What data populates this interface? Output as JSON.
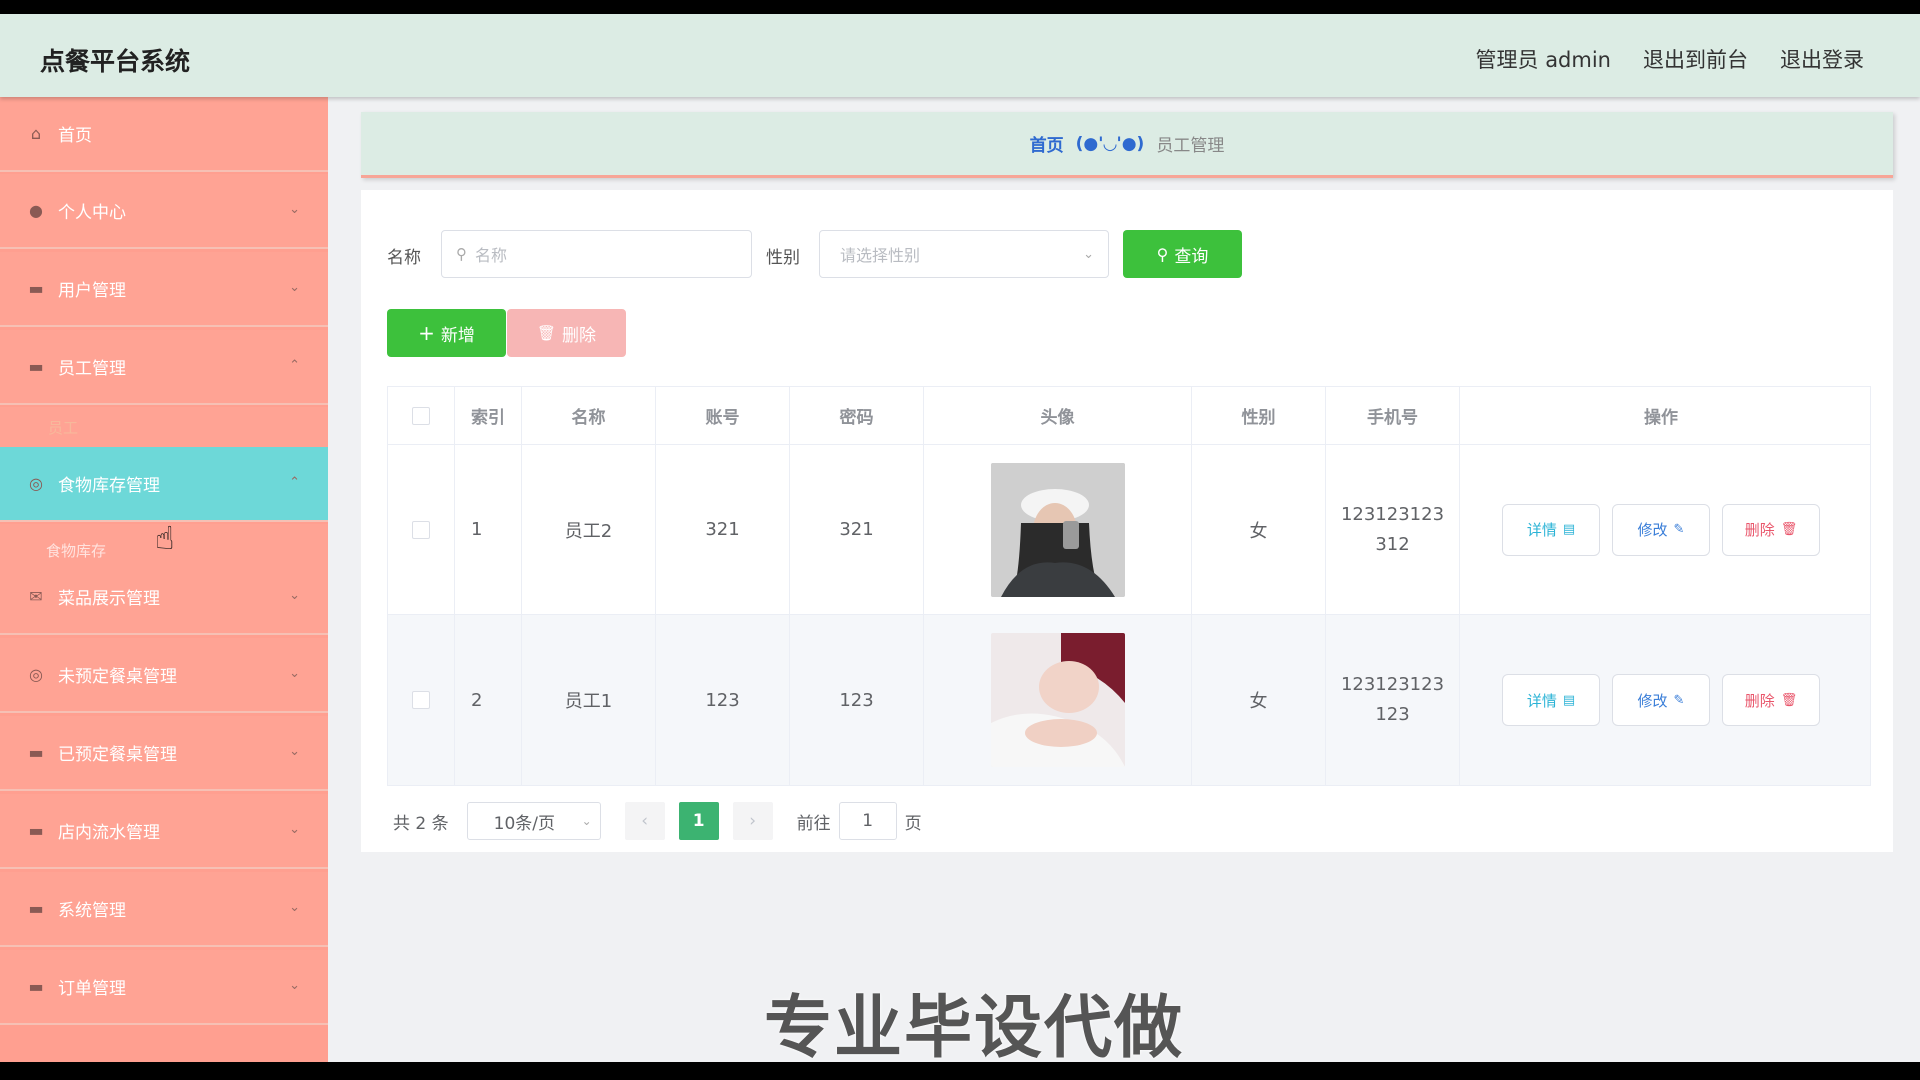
{
  "header": {
    "title": "点餐平台系统",
    "user": "管理员 admin",
    "to_front": "退出到前台",
    "logout": "退出登录"
  },
  "sidebar": {
    "items": [
      {
        "label": "首页",
        "icon": "home-icon",
        "glyph": "⌂",
        "has_chevron": false
      },
      {
        "label": "个人中心",
        "icon": "user-icon",
        "glyph": "👤",
        "has_chevron": true
      },
      {
        "label": "用户管理",
        "icon": "briefcase-icon",
        "glyph": "▬",
        "has_chevron": true
      },
      {
        "label": "员工管理",
        "icon": "monitor-icon",
        "glyph": "▬",
        "has_chevron": true
      },
      {
        "label": "食物库存管理",
        "icon": "compass-icon",
        "glyph": "◎",
        "has_chevron": true
      },
      {
        "label": "菜品展示管理",
        "icon": "mail-icon",
        "glyph": "✉",
        "has_chevron": true
      },
      {
        "label": "未预定餐桌管理",
        "icon": "lifebuoy-icon",
        "glyph": "◎",
        "has_chevron": true
      },
      {
        "label": "已预定餐桌管理",
        "icon": "message-icon",
        "glyph": "▬",
        "has_chevron": true
      },
      {
        "label": "店内流水管理",
        "icon": "ticket-icon",
        "glyph": "▬",
        "has_chevron": true
      },
      {
        "label": "系统管理",
        "icon": "system-icon",
        "glyph": "▬",
        "has_chevron": true
      },
      {
        "label": "订单管理",
        "icon": "order-icon",
        "glyph": "▬",
        "has_chevron": true
      }
    ],
    "sub_staff": "员工",
    "sub_food": "食物库存"
  },
  "breadcrumb": {
    "home": "首页",
    "separator": "(●'◡'●)",
    "current": "员工管理"
  },
  "search": {
    "name_label": "名称",
    "name_placeholder": "名称",
    "gender_label": "性别",
    "gender_placeholder": "请选择性别",
    "query_button": "查询"
  },
  "actions": {
    "add": "新增",
    "delete": "删除"
  },
  "table": {
    "columns": [
      "索引",
      "名称",
      "账号",
      "密码",
      "头像",
      "性别",
      "手机号",
      "操作"
    ],
    "rows": [
      {
        "index": "1",
        "name": "员工2",
        "account": "321",
        "password": "321",
        "gender": "女",
        "phone_line1": "123123123",
        "phone_line2": "312"
      },
      {
        "index": "2",
        "name": "员工1",
        "account": "123",
        "password": "123",
        "gender": "女",
        "phone_line1": "123123123",
        "phone_line2": "123"
      }
    ],
    "row_actions": {
      "detail": "详情",
      "edit": "修改",
      "delete": "删除"
    }
  },
  "pagination": {
    "total": "共 2 条",
    "page_size": "10条/页",
    "current_page": "1",
    "goto_label": "前往",
    "goto_value": "1",
    "page_suffix": "页"
  },
  "watermark": "专业毕设代做",
  "colors": {
    "header_bg": "#dcece4",
    "sidebar_bg": "#ffa394",
    "sidebar_active": "#6dd8d8",
    "primary_green": "#3dc13c"
  }
}
